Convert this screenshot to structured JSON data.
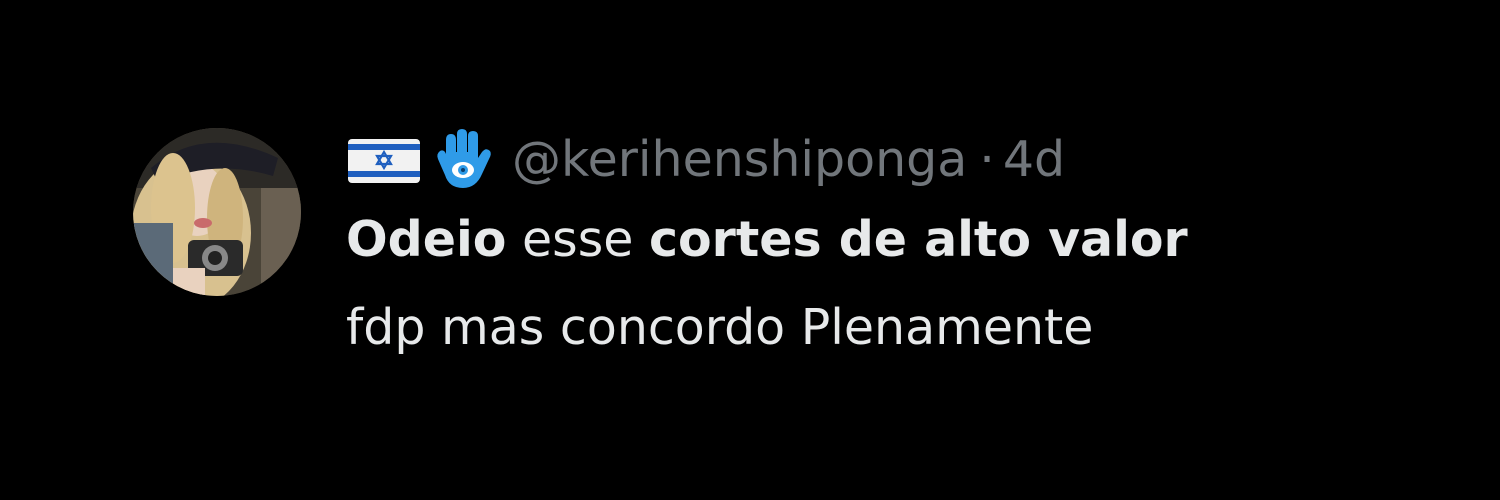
{
  "tweet": {
    "avatar_icon": "user-avatar-photo",
    "flag_icon": "israel-flag-emoji",
    "hamsa_icon": "hamsa-emoji",
    "handle": "@kerihenshiponga",
    "separator": "·",
    "time": "4d",
    "text": {
      "line1": {
        "bold1": "Odeio",
        "plain1": " esse ",
        "bold2": "cortes de alto valor"
      },
      "line2": "fdp mas concordo Plenamente"
    }
  },
  "colors": {
    "background": "#000000",
    "primary_text": "#e7e9ea",
    "secondary_text": "#71767b",
    "flag_blue": "#1f5fbf",
    "hamsa_blue": "#2f9be8"
  }
}
